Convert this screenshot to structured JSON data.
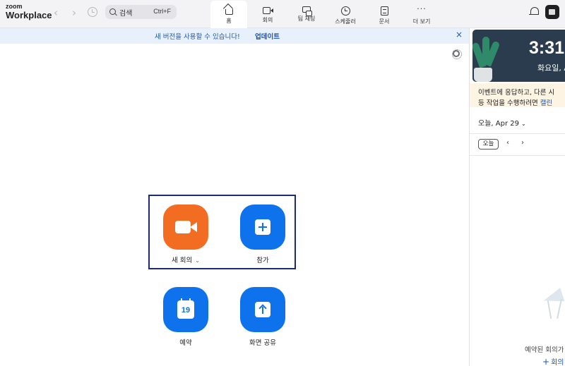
{
  "app": {
    "logo_small": "zoom",
    "logo_big": "Workplace"
  },
  "search": {
    "placeholder": "검색",
    "shortcut": "Ctrl+F"
  },
  "tabs": [
    {
      "label": "홈",
      "icon": "home-icon",
      "active": true
    },
    {
      "label": "회의",
      "icon": "video-camera-icon",
      "active": false
    },
    {
      "label": "팀 채팅",
      "icon": "chat-icon",
      "active": false
    },
    {
      "label": "스케줄러",
      "icon": "clock-icon",
      "active": false
    },
    {
      "label": "문서",
      "icon": "document-icon",
      "active": false
    },
    {
      "label": "더 보기",
      "icon": "more-icon",
      "active": false
    }
  ],
  "banner": {
    "text": "새 버전을 사용할 수 있습니다!",
    "link": "업데이트",
    "close": "×"
  },
  "actions": {
    "new_meeting": {
      "label": "새 회의",
      "chevron": "⌄"
    },
    "join": {
      "label": "참가"
    },
    "schedule": {
      "label": "예약",
      "calendar_day": "19"
    },
    "share_screen": {
      "label": "화면 공유"
    }
  },
  "right_panel": {
    "clock_time": "3:31",
    "clock_date": "화요일, A",
    "promo_line1": "이벤트에 응답하고, 다른 시",
    "promo_line2_prefix": "등 작업을 수행하려면 ",
    "promo_link": "캘린",
    "date_selector": "오늘, Apr 29",
    "date_chevron": "⌄",
    "today_button": "오늘",
    "prev": "‹",
    "next": "›",
    "empty_text": "예약된 회의가",
    "schedule_link": "회의"
  },
  "colors": {
    "accent_blue": "#0e72ed",
    "orange": "#f26d21",
    "highlight_border": "#1b2a7a",
    "banner_bg": "#e8f1fb"
  }
}
